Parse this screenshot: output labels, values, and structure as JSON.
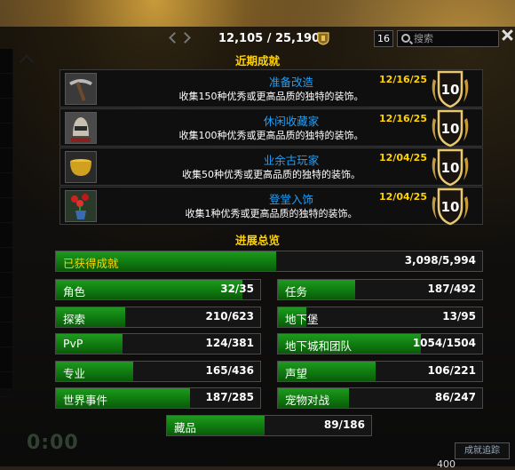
{
  "header": {
    "points": "12,105 / 25,190",
    "count_badge": "16",
    "search_placeholder": "搜索"
  },
  "recent": {
    "title": "近期成就",
    "items": [
      {
        "name": "准备改造",
        "date": "12/16/25",
        "desc": "收集150种优秀或更高品质的独特的装饰。",
        "points": "10",
        "icon": "mining-pick-icon"
      },
      {
        "name": "休闲收藏家",
        "date": "12/16/25",
        "desc": "收集100种优秀或更高品质的独特的装饰。",
        "points": "10",
        "icon": "helmet-icon"
      },
      {
        "name": "业余古玩家",
        "date": "12/04/25",
        "desc": "收集50种优秀或更高品质的独特的装饰。",
        "points": "10",
        "icon": "golden-pot-icon"
      },
      {
        "name": "登堂入饰",
        "date": "12/04/25",
        "desc": "收集1种优秀或更高品质的独特的装饰。",
        "points": "10",
        "icon": "flower-vase-icon"
      }
    ]
  },
  "overview": {
    "title": "进展总览",
    "total": {
      "label": "已获得成就",
      "value": "3,098/5,994",
      "ratio": 0.517
    },
    "categories": [
      {
        "label": "角色",
        "value": "32/35",
        "ratio": 0.914
      },
      {
        "label": "任务",
        "value": "187/492",
        "ratio": 0.38
      },
      {
        "label": "探索",
        "value": "210/623",
        "ratio": 0.337
      },
      {
        "label": "地下堡",
        "value": "13/95",
        "ratio": 0.137
      },
      {
        "label": "PvP",
        "value": "124/381",
        "ratio": 0.325
      },
      {
        "label": "地下城和团队",
        "value": "1054/1504",
        "ratio": 0.701
      },
      {
        "label": "专业",
        "value": "165/436",
        "ratio": 0.378
      },
      {
        "label": "声望",
        "value": "106/221",
        "ratio": 0.48
      },
      {
        "label": "世界事件",
        "value": "187/285",
        "ratio": 0.656
      },
      {
        "label": "宠物对战",
        "value": "86/247",
        "ratio": 0.348
      }
    ],
    "collections": {
      "label": "藏品",
      "value": "89/186",
      "ratio": 0.478
    }
  },
  "footer": {
    "track_button": "成就追踪",
    "timer": "0:00",
    "bottom_number": "400"
  },
  "colors": {
    "gold": "#ffd200",
    "blue": "#1aa0ff",
    "green": "#1e9a1e"
  }
}
